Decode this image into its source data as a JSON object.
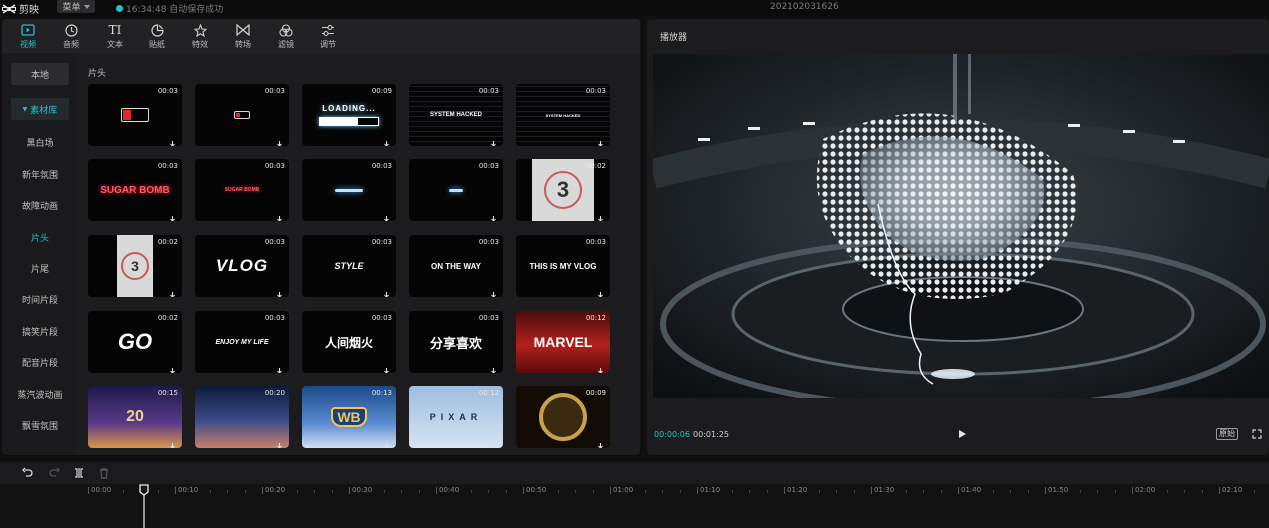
{
  "app": {
    "name": "剪映",
    "menu_label": "菜单",
    "save_status": "16:34:48 自动保存成功",
    "project_title": "202102031626",
    "accent": "#27c1c9"
  },
  "toolbar": {
    "tabs": [
      {
        "label": "视频",
        "icon": "video-icon",
        "active": true
      },
      {
        "label": "音频",
        "icon": "audio-icon"
      },
      {
        "label": "文本",
        "icon": "text-icon"
      },
      {
        "label": "贴纸",
        "icon": "sticker-icon"
      },
      {
        "label": "特效",
        "icon": "effects-icon"
      },
      {
        "label": "转场",
        "icon": "transition-icon"
      },
      {
        "label": "滤镜",
        "icon": "filter-icon"
      },
      {
        "label": "调节",
        "icon": "adjust-icon"
      }
    ]
  },
  "sidebar": {
    "items": [
      {
        "label": "本地"
      },
      {
        "label": "素材库"
      },
      {
        "label": "黑白场"
      },
      {
        "label": "新年氛围"
      },
      {
        "label": "故障动画"
      },
      {
        "label": "片头"
      },
      {
        "label": "片尾"
      },
      {
        "label": "时间片段"
      },
      {
        "label": "搞笑片段"
      },
      {
        "label": "配音片段"
      },
      {
        "label": "蒸汽波动画"
      },
      {
        "label": "飘雪氛围"
      }
    ]
  },
  "library": {
    "section_label": "片头",
    "cards": [
      {
        "duration": "00:03",
        "art": "battery",
        "text": ""
      },
      {
        "duration": "00:03",
        "art": "battery-small",
        "text": ""
      },
      {
        "duration": "00:09",
        "art": "loading",
        "text": "LOADING..."
      },
      {
        "duration": "00:03",
        "art": "glitch",
        "text": "SYSTEM HACKED"
      },
      {
        "duration": "00:03",
        "art": "glitch-small",
        "text": "SYSTEM HACKED"
      },
      {
        "duration": "00:03",
        "art": "neon",
        "text": "SUGAR BOMB"
      },
      {
        "duration": "00:03",
        "art": "neon-small",
        "text": "SUGAR BOMB"
      },
      {
        "duration": "00:03",
        "art": "bar",
        "text": ""
      },
      {
        "duration": "00:03",
        "art": "bar-small",
        "text": ""
      },
      {
        "duration": "00:02",
        "art": "countdown",
        "text": "3"
      },
      {
        "duration": "00:02",
        "art": "countdown-small",
        "text": "3"
      },
      {
        "duration": "00:03",
        "art": "vlog",
        "text": "VLOG"
      },
      {
        "duration": "00:03",
        "art": "style",
        "text": "STYLE"
      },
      {
        "duration": "00:03",
        "art": "ontheway",
        "text": "ON THE WAY"
      },
      {
        "duration": "00:03",
        "art": "thisismyvlog",
        "text": "THIS IS MY VLOG"
      },
      {
        "duration": "00:02",
        "art": "go",
        "text": "GO"
      },
      {
        "duration": "00:03",
        "art": "enjoy",
        "text": "ENJOY MY LIFE"
      },
      {
        "duration": "00:03",
        "art": "calligraphy",
        "text": "人间烟火"
      },
      {
        "duration": "00:03",
        "art": "share",
        "text": "分享喜欢"
      },
      {
        "duration": "00:12",
        "art": "marvel",
        "text": "MARVEL"
      },
      {
        "duration": "00:15",
        "art": "fox",
        "text": "20"
      },
      {
        "duration": "00:20",
        "art": "disney",
        "text": ""
      },
      {
        "duration": "00:13",
        "art": "wb",
        "text": "WB"
      },
      {
        "duration": "00:12",
        "art": "pixar",
        "text": "PIXAR"
      },
      {
        "duration": "00:09",
        "art": "mgm",
        "text": ""
      }
    ]
  },
  "player": {
    "title": "播放器",
    "current_time": "00:00:06",
    "total_time": "00:01:25",
    "ratio_label": "原始"
  },
  "timeline": {
    "ruler_labels": [
      "00:00",
      "00:10",
      "00:20",
      "00:30",
      "00:40",
      "00:50",
      "01:00",
      "01:10",
      "01:20",
      "01:30",
      "01:40",
      "01:50",
      "02:00",
      "02:10"
    ]
  }
}
